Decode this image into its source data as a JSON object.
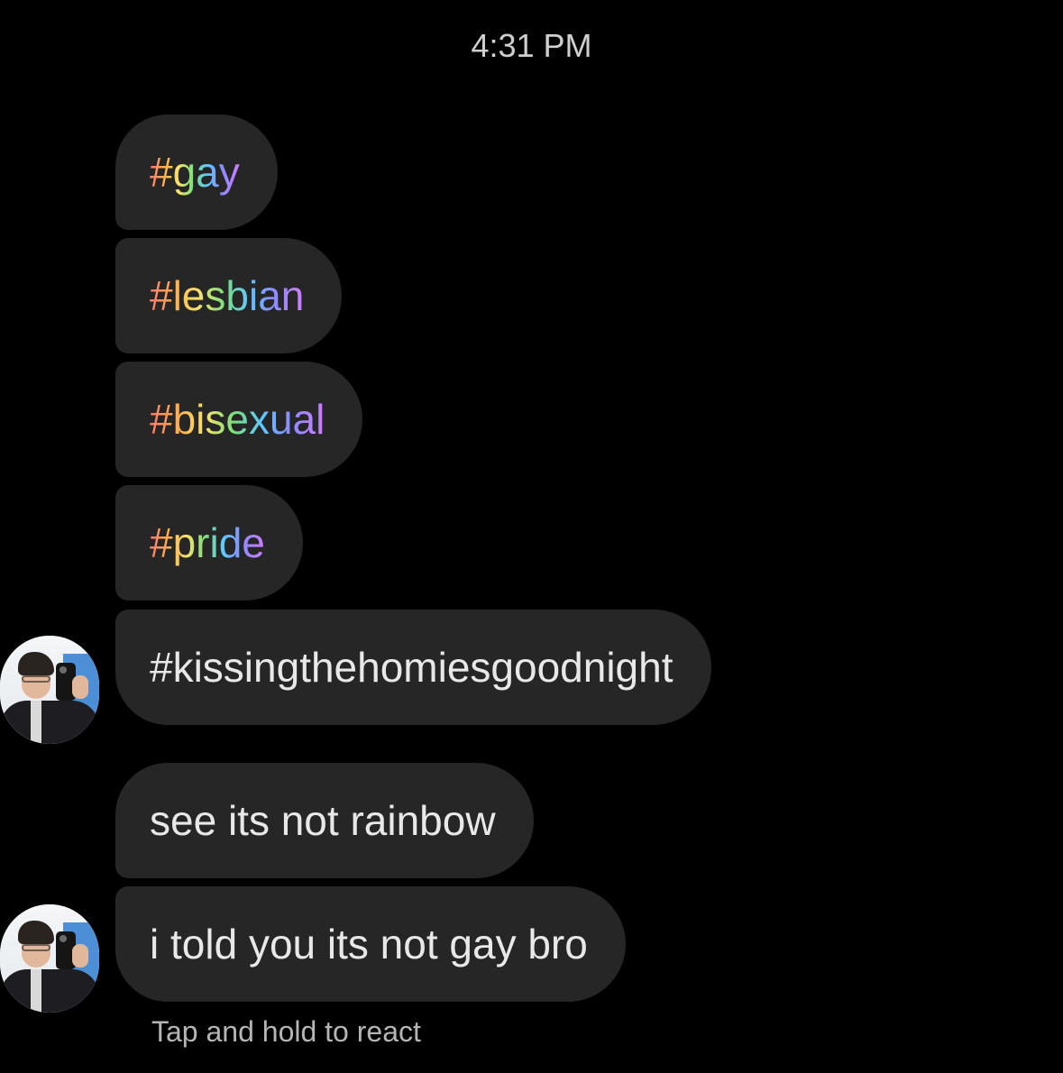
{
  "chat": {
    "timestamp": "4:31 PM",
    "messages": [
      {
        "text": "#gay"
      },
      {
        "text": "#lesbian"
      },
      {
        "text": "#bisexual"
      },
      {
        "text": "#pride"
      },
      {
        "text": "#kissingthehomiesgoodnight"
      },
      {
        "text": "see its not rainbow"
      },
      {
        "text": "i told you its not gay bro"
      }
    ],
    "react_hint": "Tap and hold to react"
  },
  "colors": {
    "background": "#000000",
    "bubble": "#262626",
    "text": "#e8e8e8",
    "hint": "#b5b5b5"
  }
}
